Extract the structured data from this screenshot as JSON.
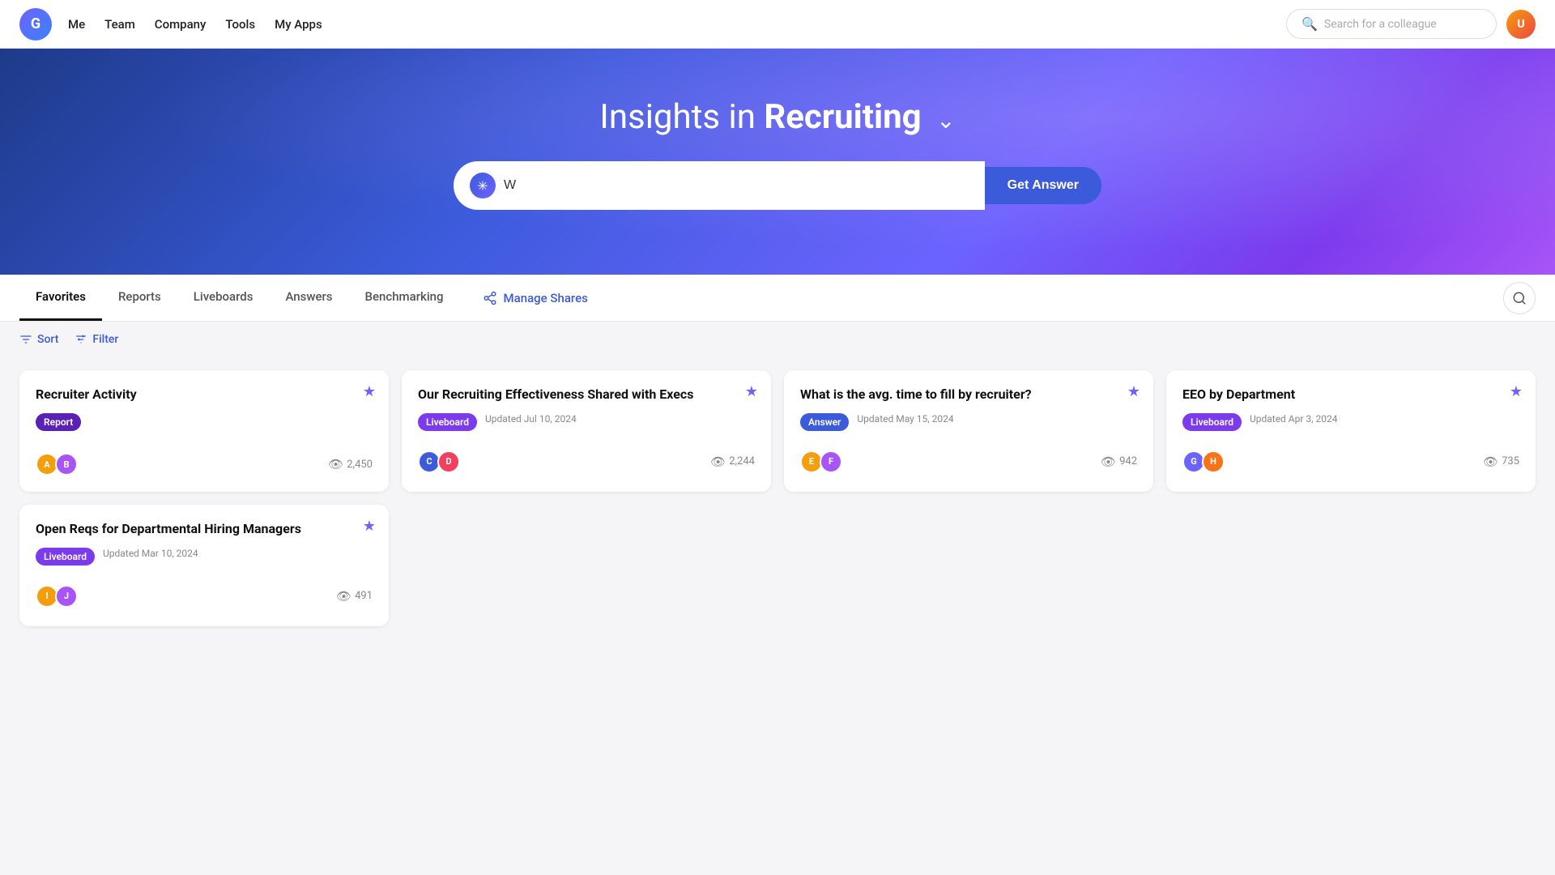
{
  "app": {
    "logo_letter": "G"
  },
  "nav": {
    "links": [
      {
        "id": "me",
        "label": "Me"
      },
      {
        "id": "team",
        "label": "Team"
      },
      {
        "id": "company",
        "label": "Company"
      },
      {
        "id": "tools",
        "label": "Tools"
      },
      {
        "id": "my-apps",
        "label": "My Apps"
      }
    ]
  },
  "search_colleague": {
    "placeholder": "Search for a colleague"
  },
  "hero": {
    "title_prefix": "Insights in ",
    "title_emphasis": "Recruiting",
    "search_value": "W",
    "get_answer_label": "Get Answer"
  },
  "tabs": [
    {
      "id": "favorites",
      "label": "Favorites",
      "active": true
    },
    {
      "id": "reports",
      "label": "Reports",
      "active": false
    },
    {
      "id": "liveboards",
      "label": "Liveboards",
      "active": false
    },
    {
      "id": "answers",
      "label": "Answers",
      "active": false
    },
    {
      "id": "benchmarking",
      "label": "Benchmarking",
      "active": false
    }
  ],
  "manage_shares": {
    "label": "Manage Shares"
  },
  "toolbar": {
    "sort_label": "Sort",
    "filter_label": "Filter"
  },
  "cards": [
    {
      "id": "card-1",
      "title": "Recruiter Activity",
      "badge": "Report",
      "badge_type": "report",
      "updated": "",
      "views": "2,450",
      "starred": true,
      "avatars": [
        "#f59e0b",
        "#a855f7"
      ]
    },
    {
      "id": "card-2",
      "title": "Our Recruiting Effectiveness Shared with Execs",
      "badge": "Liveboard",
      "badge_type": "liveboard",
      "updated": "Updated Jul 10, 2024",
      "views": "2,244",
      "starred": true,
      "avatars": [
        "#3b5bdb",
        "#f43f5e"
      ]
    },
    {
      "id": "card-3",
      "title": "What is the avg. time to fill by recruiter?",
      "badge": "Answer",
      "badge_type": "answer",
      "updated": "Updated May 15, 2024",
      "views": "942",
      "starred": true,
      "avatars": [
        "#f59e0b",
        "#a855f7"
      ]
    },
    {
      "id": "card-4",
      "title": "EEO by Department",
      "badge": "Liveboard",
      "badge_type": "liveboard",
      "updated": "Updated Apr 3, 2024",
      "views": "735",
      "starred": true,
      "avatars": [
        "#6c63ff",
        "#f97316"
      ]
    }
  ],
  "cards_row2": [
    {
      "id": "card-5",
      "title": "Open Reqs for Departmental Hiring Managers",
      "badge": "Liveboard",
      "badge_type": "liveboard",
      "updated": "Updated Mar 10, 2024",
      "views": "491",
      "starred": true,
      "avatars": [
        "#f59e0b",
        "#a855f7"
      ]
    }
  ]
}
